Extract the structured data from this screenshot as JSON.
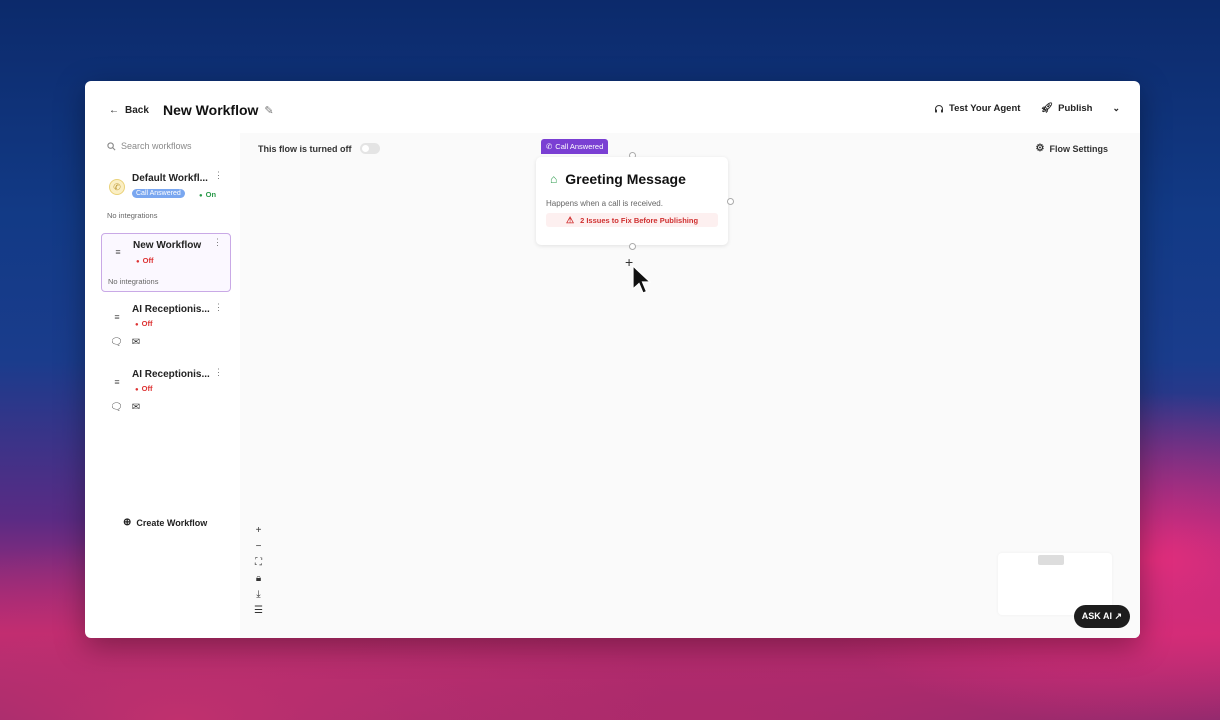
{
  "header": {
    "back_label": "Back",
    "title": "New Workflow",
    "test_agent_label": "Test Your Agent",
    "publish_label": "Publish"
  },
  "sidebar": {
    "search_placeholder": "Search workflows",
    "workflows": [
      {
        "name": "Default Workfl...",
        "badge": "Call Answered",
        "status": "On",
        "integrations": "No integrations"
      },
      {
        "name": "New Workflow",
        "status": "Off",
        "integrations": "No integrations"
      },
      {
        "name": "AI Receptionis...",
        "status": "Off"
      },
      {
        "name": "AI Receptionis...",
        "status": "Off"
      }
    ],
    "create_label": "Create Workflow"
  },
  "canvas": {
    "flow_status_label": "This flow is turned off",
    "flow_settings_label": "Flow Settings",
    "node": {
      "tag": "Call Answered",
      "title": "Greeting Message",
      "description": "Happens when a call is received.",
      "issues": "2 Issues to Fix Before Publishing"
    },
    "ask_ai_label": "ASK AI ↗"
  },
  "colors": {
    "accent_purple": "#7a3fd3",
    "status_on": "#2a9a4a",
    "status_off": "#d33333"
  }
}
